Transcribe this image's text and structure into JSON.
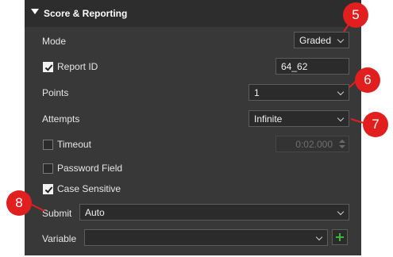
{
  "section": {
    "title": "Score & Reporting"
  },
  "mode": {
    "label": "Mode",
    "value": "Graded"
  },
  "report_id": {
    "label": "Report ID",
    "checked": true,
    "value": "64_62"
  },
  "points": {
    "label": "Points",
    "value": "1"
  },
  "attempts": {
    "label": "Attempts",
    "value": "Infinite"
  },
  "timeout": {
    "label": "Timeout",
    "checked": false,
    "value": "0:02.000"
  },
  "password_field": {
    "label": "Password Field",
    "checked": false
  },
  "case_sensitive": {
    "label": "Case Sensitive",
    "checked": true
  },
  "submit": {
    "label": "Submit",
    "value": "Auto"
  },
  "variable": {
    "label": "Variable",
    "value": ""
  },
  "callouts": [
    "5",
    "6",
    "7",
    "8"
  ],
  "colors": {
    "panel": "#383838",
    "header": "#2d2d2d",
    "callout": "#e21f1f",
    "add_icon": "#3ab83a"
  }
}
